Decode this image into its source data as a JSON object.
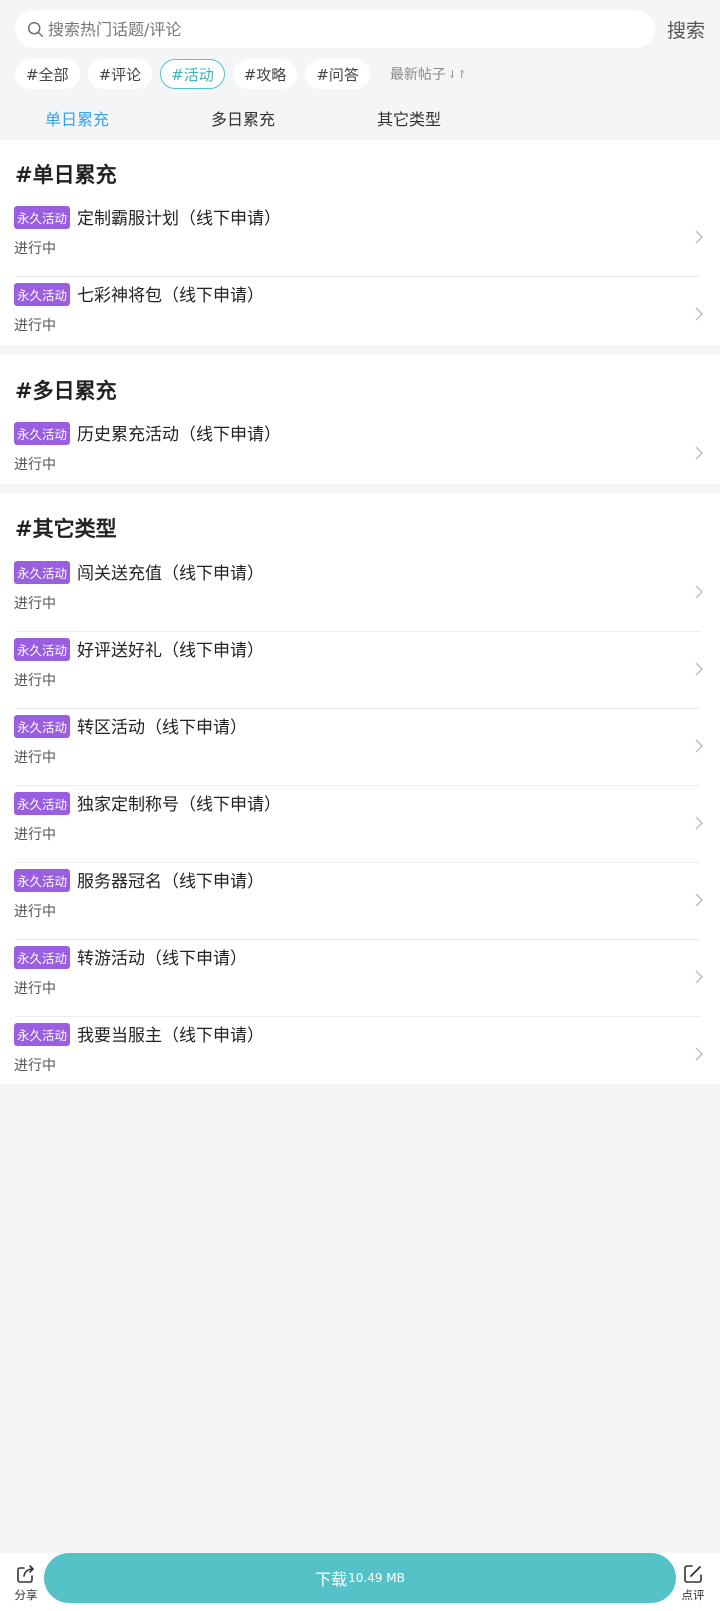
{
  "search": {
    "placeholder": "搜索热门话题/评论",
    "button_label": "搜索"
  },
  "filters": {
    "chips": [
      "#全部",
      "#评论",
      "#活动",
      "#攻略",
      "#问答"
    ],
    "active_index": 2,
    "sort_label": "最新帖子",
    "sort_icon": "⇃↾"
  },
  "subtabs": {
    "items": [
      "单日累充",
      "多日累充",
      "其它类型"
    ],
    "active_index": 0
  },
  "sections": [
    {
      "title": "#单日累充",
      "items": [
        {
          "badge": "永久活动",
          "title": "定制霸服计划（线下申请）",
          "status": "进行中"
        },
        {
          "badge": "永久活动",
          "title": "七彩神将包（线下申请）",
          "status": "进行中"
        }
      ]
    },
    {
      "title": "#多日累充",
      "items": [
        {
          "badge": "永久活动",
          "title": "历史累充活动（线下申请）",
          "status": "进行中"
        }
      ]
    },
    {
      "title": "#其它类型",
      "items": [
        {
          "badge": "永久活动",
          "title": "闯关送充值（线下申请）",
          "status": "进行中"
        },
        {
          "badge": "永久活动",
          "title": "好评送好礼（线下申请）",
          "status": "进行中"
        },
        {
          "badge": "永久活动",
          "title": "转区活动（线下申请）",
          "status": "进行中"
        },
        {
          "badge": "永久活动",
          "title": "独家定制称号（线下申请）",
          "status": "进行中"
        },
        {
          "badge": "永久活动",
          "title": "服务器冠名（线下申请）",
          "status": "进行中"
        },
        {
          "badge": "永久活动",
          "title": "转游活动（线下申请）",
          "status": "进行中"
        },
        {
          "badge": "永久活动",
          "title": "我要当服主（线下申请）",
          "status": "进行中"
        }
      ]
    }
  ],
  "bottom_bar": {
    "share_label": "分享",
    "download_label": "下载",
    "download_size": "10.49 MB",
    "review_label": "点评"
  },
  "colors": {
    "accent": "#55c2c8",
    "active_tab": "#3ca0e8",
    "badge": "#9a5fe0",
    "background": "#f4f5f7"
  },
  "icons": {
    "search": "search-icon",
    "chevron": "chevron-right-icon",
    "share": "share-icon",
    "review": "edit-icon"
  }
}
